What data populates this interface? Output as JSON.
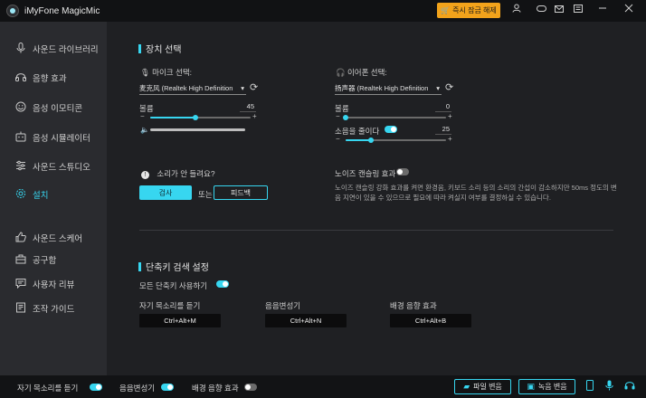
{
  "titlebar": {
    "app_title": "iMyFone MagicMic",
    "upgrade_label": "즉시 잠금 해제",
    "icons": [
      "user-icon",
      "gamepad-icon",
      "mail-icon",
      "menu-icon",
      "minimize-icon",
      "close-icon"
    ]
  },
  "sidebar": {
    "items": [
      {
        "label": "사운드 라이브러리",
        "icon": "mic-icon"
      },
      {
        "label": "음향 효과",
        "icon": "headphones-icon"
      },
      {
        "label": "음성 이모티콘",
        "icon": "smile-icon"
      },
      {
        "label": "음성 시뮬레이터",
        "icon": "robot-icon"
      },
      {
        "label": "사운드 스튜디오",
        "icon": "sliders-icon"
      },
      {
        "label": "설치",
        "icon": "gear-icon",
        "active": true
      },
      {
        "label": "사운드 스케어",
        "icon": "thumbs-up-icon"
      },
      {
        "label": "공구함",
        "icon": "toolbox-icon"
      },
      {
        "label": "사용자 리뷰",
        "icon": "chat-icon"
      },
      {
        "label": "조작 가이드",
        "icon": "book-icon"
      }
    ]
  },
  "device": {
    "section_title": "장치 선택",
    "mic": {
      "label": "마이크 선택:",
      "selected": "麦克风 (Realtek High Definition",
      "volume_label": "볼륨",
      "volume_value": "45",
      "volume": 45
    },
    "speaker": {
      "label": "이어폰 선택:",
      "selected": "扬声器 (Realtek High Definition",
      "volume_label": "볼륨",
      "volume_value": "0",
      "volume": 0,
      "amplify_label": "소음을 줄이다",
      "amplify_value": "25",
      "amplify": 25,
      "amplify_on": true
    },
    "no_sound_label": "소리가 안 들려요?",
    "check_button": "검사",
    "or_label": "또는",
    "feedback_button": "피드백",
    "noise_label": "노이즈 캔슬링 효과",
    "noise_on": false,
    "noise_desc": "노이즈 캔슬링 강화 효과를 켜면 환경음, 키보드 소리 등의 소리의 간섭이 감소하지만 50ms 정도의 변음 지연이 있을 수 있으므로 필요에 따라 켜실지 여부를 결정하실 수 있습니다."
  },
  "hotkeys": {
    "section_title": "단축키 검색 설정",
    "enable_label": "모든 단축키 사용하기",
    "enabled": true,
    "items": [
      {
        "label": "자기 목소리를 듣기",
        "key": "Ctrl+Alt+M"
      },
      {
        "label": "음음변성기",
        "key": "Ctrl+Alt+N"
      },
      {
        "label": "배경 음향 효과",
        "key": "Ctrl+Alt+B"
      }
    ]
  },
  "bottombar": {
    "hear_self_label": "자기 목소리를 듣기",
    "hear_self_on": true,
    "voice_changer_label": "음음변성기",
    "voice_changer_on": true,
    "bg_effect_label": "배경 음향 효과",
    "bg_effect_on": false,
    "file_button": "파일 변음",
    "record_button": "녹음 변음"
  },
  "colors": {
    "accent": "#37d6f0",
    "upgrade": "#f2a31b"
  }
}
